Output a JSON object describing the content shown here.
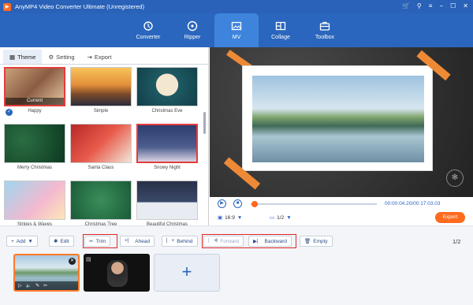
{
  "app": {
    "title": "AnyMP4 Video Converter Ultimate (Unregistered)",
    "logo_icon": "anymp4-logo-icon"
  },
  "window_controls": [
    "cart-icon",
    "user-icon",
    "menu-icon",
    "minimize-icon",
    "maximize-icon",
    "close-icon"
  ],
  "nav": [
    {
      "label": "Converter",
      "icon": "converter-icon"
    },
    {
      "label": "Ripper",
      "icon": "ripper-icon"
    },
    {
      "label": "MV",
      "icon": "mv-icon",
      "active": true
    },
    {
      "label": "Collage",
      "icon": "collage-icon"
    },
    {
      "label": "Toolbox",
      "icon": "toolbox-icon"
    }
  ],
  "tabs": [
    {
      "label": "Theme",
      "icon": "theme-icon",
      "active": true
    },
    {
      "label": "Setting",
      "icon": "gear-icon"
    },
    {
      "label": "Export",
      "icon": "export-icon"
    }
  ],
  "themes": [
    {
      "name": "Happy",
      "current": true,
      "current_label": "Current"
    },
    {
      "name": "Simple"
    },
    {
      "name": "Christmas Eve"
    },
    {
      "name": "Merry Christmas"
    },
    {
      "name": "Santa Claus"
    },
    {
      "name": "Snowy Night",
      "selected": true
    },
    {
      "name": "Stripes & Waves"
    },
    {
      "name": "Christmas Tree"
    },
    {
      "name": "Beautiful Christmas"
    }
  ],
  "player": {
    "time_current": "00:00:04.20",
    "time_total": "00:17:03.03",
    "aspect_ratio": "16:9",
    "page": "1/2",
    "export_label": "Export",
    "progress": 0.005
  },
  "toolbar": {
    "add": "Add",
    "edit": "Edit",
    "trim": "Trim",
    "ahead": "Ahead",
    "behind": "Behind",
    "forward": "Forward",
    "backward": "Backward",
    "empty": "Empty",
    "page": "1/2"
  },
  "colors": {
    "brand_blue": "#2a66bd",
    "accent_orange": "#ff6a1f",
    "highlight_red": "#e02525"
  }
}
